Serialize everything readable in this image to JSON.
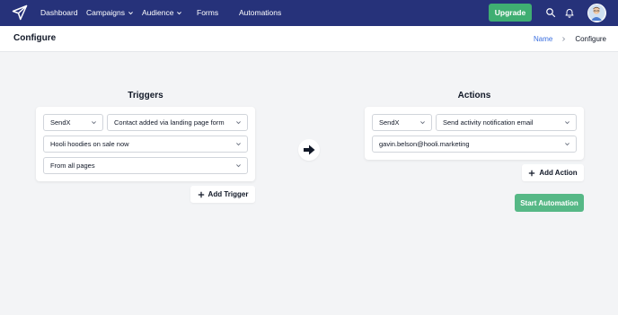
{
  "nav": {
    "items": [
      {
        "label": "Dashboard",
        "has_menu": false
      },
      {
        "label": "Campaigns",
        "has_menu": true
      },
      {
        "label": "Audience",
        "has_menu": true
      },
      {
        "label": "Forms",
        "has_menu": false
      },
      {
        "label": "Automations",
        "has_menu": false
      }
    ],
    "upgrade_label": "Upgrade",
    "icons": [
      "paper-plane-logo-icon",
      "search-icon",
      "bell-icon",
      "avatar"
    ]
  },
  "header": {
    "title": "Configure",
    "breadcrumb": [
      "Name",
      "Configure"
    ]
  },
  "triggers": {
    "title": "Triggers",
    "rows": {
      "source": "SendX",
      "event": "Contact added via landing page form",
      "form": "Hooli hoodies on sale now",
      "pages": "From all pages"
    },
    "add_label": "Add Trigger"
  },
  "actions": {
    "title": "Actions",
    "rows": {
      "source": "SendX",
      "action": "Send activity notification email",
      "email": "gavin.belson@hooli.marketing"
    },
    "add_label": "Add Action"
  },
  "start_label": "Start Automation",
  "colors": {
    "nav_bg": "#26327a",
    "upgrade": "#3fae72",
    "start": "#56b886",
    "link": "#3b6fe0",
    "page_bg": "#f3f4f6"
  }
}
